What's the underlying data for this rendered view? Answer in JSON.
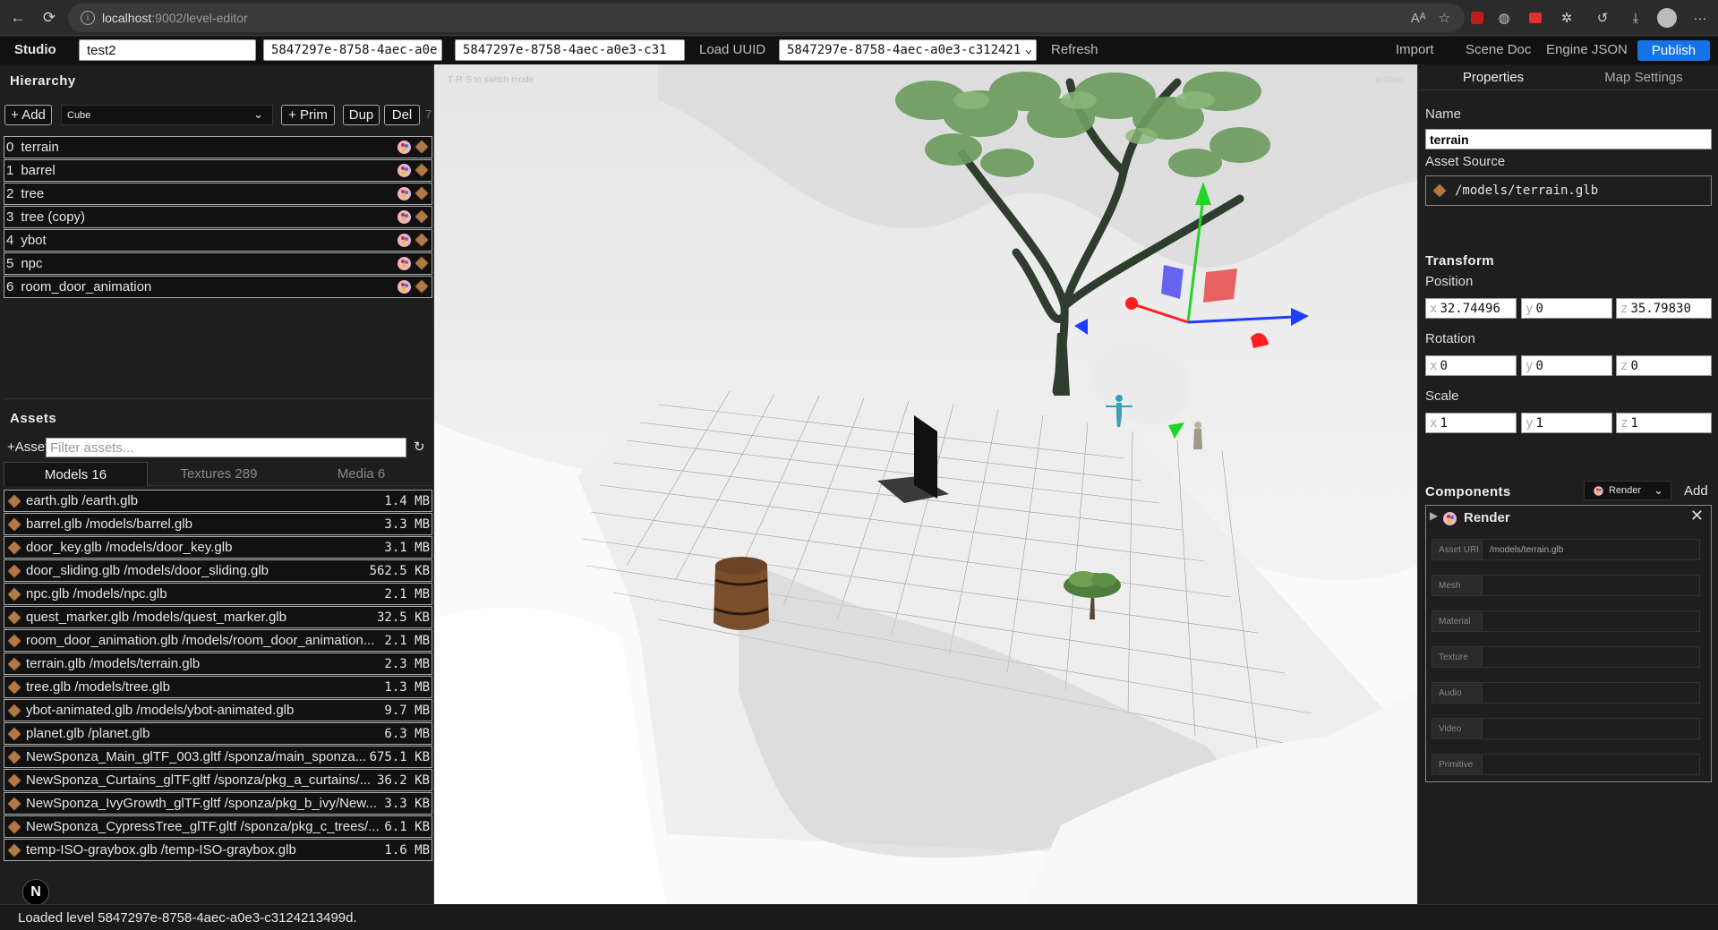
{
  "browser": {
    "url_host": "localhost",
    "url_rest": ":9002/level-editor"
  },
  "toolbar": {
    "brand": "Studio",
    "level_name": "test2",
    "uuid_field_1": "5847297e-8758-4aec-a0e",
    "uuid_field_2": "5847297e-8758-4aec-a0e3-c31",
    "load_uuid": "Load UUID",
    "uuid_select": "5847297e-8758-4aec-a0e3-c312421",
    "refresh": "Refresh",
    "import": "Import",
    "scene_doc": "Scene Doc",
    "engine_json": "Engine JSON",
    "publish": "Publish"
  },
  "hierarchy": {
    "title": "Hierarchy",
    "add": "+ Add",
    "primitive": "Cube",
    "prim": "+ Prim",
    "dup": "Dup",
    "del": "Del",
    "count": "7",
    "items": [
      {
        "index": "0",
        "name": "terrain"
      },
      {
        "index": "1",
        "name": "barrel"
      },
      {
        "index": "2",
        "name": "tree"
      },
      {
        "index": "3",
        "name": "tree (copy)"
      },
      {
        "index": "4",
        "name": "ybot"
      },
      {
        "index": "5",
        "name": "npc"
      },
      {
        "index": "6",
        "name": "room_door_animation"
      }
    ]
  },
  "assets": {
    "title": "Assets",
    "add": "+Asset",
    "filter_placeholder": "Filter assets...",
    "refresh_icon": "↻",
    "tabs": [
      {
        "label": "Models 16"
      },
      {
        "label": "Textures 289"
      },
      {
        "label": "Media 6"
      }
    ],
    "items": [
      {
        "name": "earth.glb /earth.glb",
        "size": "1.4 MB"
      },
      {
        "name": "barrel.glb /models/barrel.glb",
        "size": "3.3 MB"
      },
      {
        "name": "door_key.glb /models/door_key.glb",
        "size": "3.1 MB"
      },
      {
        "name": "door_sliding.glb /models/door_sliding.glb",
        "size": "562.5 KB"
      },
      {
        "name": "npc.glb /models/npc.glb",
        "size": "2.1 MB"
      },
      {
        "name": "quest_marker.glb /models/quest_marker.glb",
        "size": "32.5 KB"
      },
      {
        "name": "room_door_animation.glb /models/room_door_animation...",
        "size": "2.1 MB"
      },
      {
        "name": "terrain.glb /models/terrain.glb",
        "size": "2.3 MB"
      },
      {
        "name": "tree.glb /models/tree.glb",
        "size": "1.3 MB"
      },
      {
        "name": "ybot-animated.glb /models/ybot-animated.glb",
        "size": "9.7 MB"
      },
      {
        "name": "planet.glb /planet.glb",
        "size": "6.3 MB"
      },
      {
        "name": "NewSponza_Main_glTF_003.gltf /sponza/main_sponza...",
        "size": "675.1 KB"
      },
      {
        "name": "NewSponza_Curtains_glTF.gltf /sponza/pkg_a_curtains/...",
        "size": "36.2 KB"
      },
      {
        "name": "NewSponza_IvyGrowth_glTF.gltf /sponza/pkg_b_ivy/New...",
        "size": "3.3 KB"
      },
      {
        "name": "NewSponza_CypressTree_glTF.gltf /sponza/pkg_c_trees/...",
        "size": "6.1 KB"
      },
      {
        "name": "temp-ISO-graybox.glb /temp-ISO-graybox.glb",
        "size": "1.6 MB"
      }
    ]
  },
  "viewport": {
    "hint": "T·R·S to switch mode",
    "entities": "entities"
  },
  "properties": {
    "tab_properties": "Properties",
    "tab_map_settings": "Map Settings",
    "name_label": "Name",
    "name_value": "terrain",
    "asset_source_label": "Asset Source",
    "asset_source_value": "/models/terrain.glb",
    "transform_label": "Transform",
    "position_label": "Position",
    "position": {
      "x": "32.74496",
      "y": "0",
      "z": "35.79830"
    },
    "rotation_label": "Rotation",
    "rotation": {
      "x": "0",
      "y": "0",
      "z": "0"
    },
    "scale_label": "Scale",
    "scale": {
      "x": "1",
      "y": "1",
      "z": "1"
    },
    "components_label": "Components",
    "component_select": "Render",
    "add": "Add",
    "render_title": "Render",
    "render_fields": [
      {
        "key": "Asset URI",
        "value": "/models/terrain.glb"
      },
      {
        "key": "Mesh",
        "value": ""
      },
      {
        "key": "Material",
        "value": ""
      },
      {
        "key": "Texture",
        "value": ""
      },
      {
        "key": "Audio",
        "value": ""
      },
      {
        "key": "Video",
        "value": ""
      },
      {
        "key": "Primitive",
        "value": ""
      }
    ]
  },
  "status": {
    "message": "Loaded level 5847297e-8758-4aec-a0e3-c3124213499d."
  },
  "n_badge": "N",
  "colors": {
    "publish": "#1473e6",
    "gizmo_x": "#ff1f1f",
    "gizmo_y": "#22d522",
    "gizmo_z": "#1f3cff",
    "panel_bg": "#1e1e1e"
  }
}
